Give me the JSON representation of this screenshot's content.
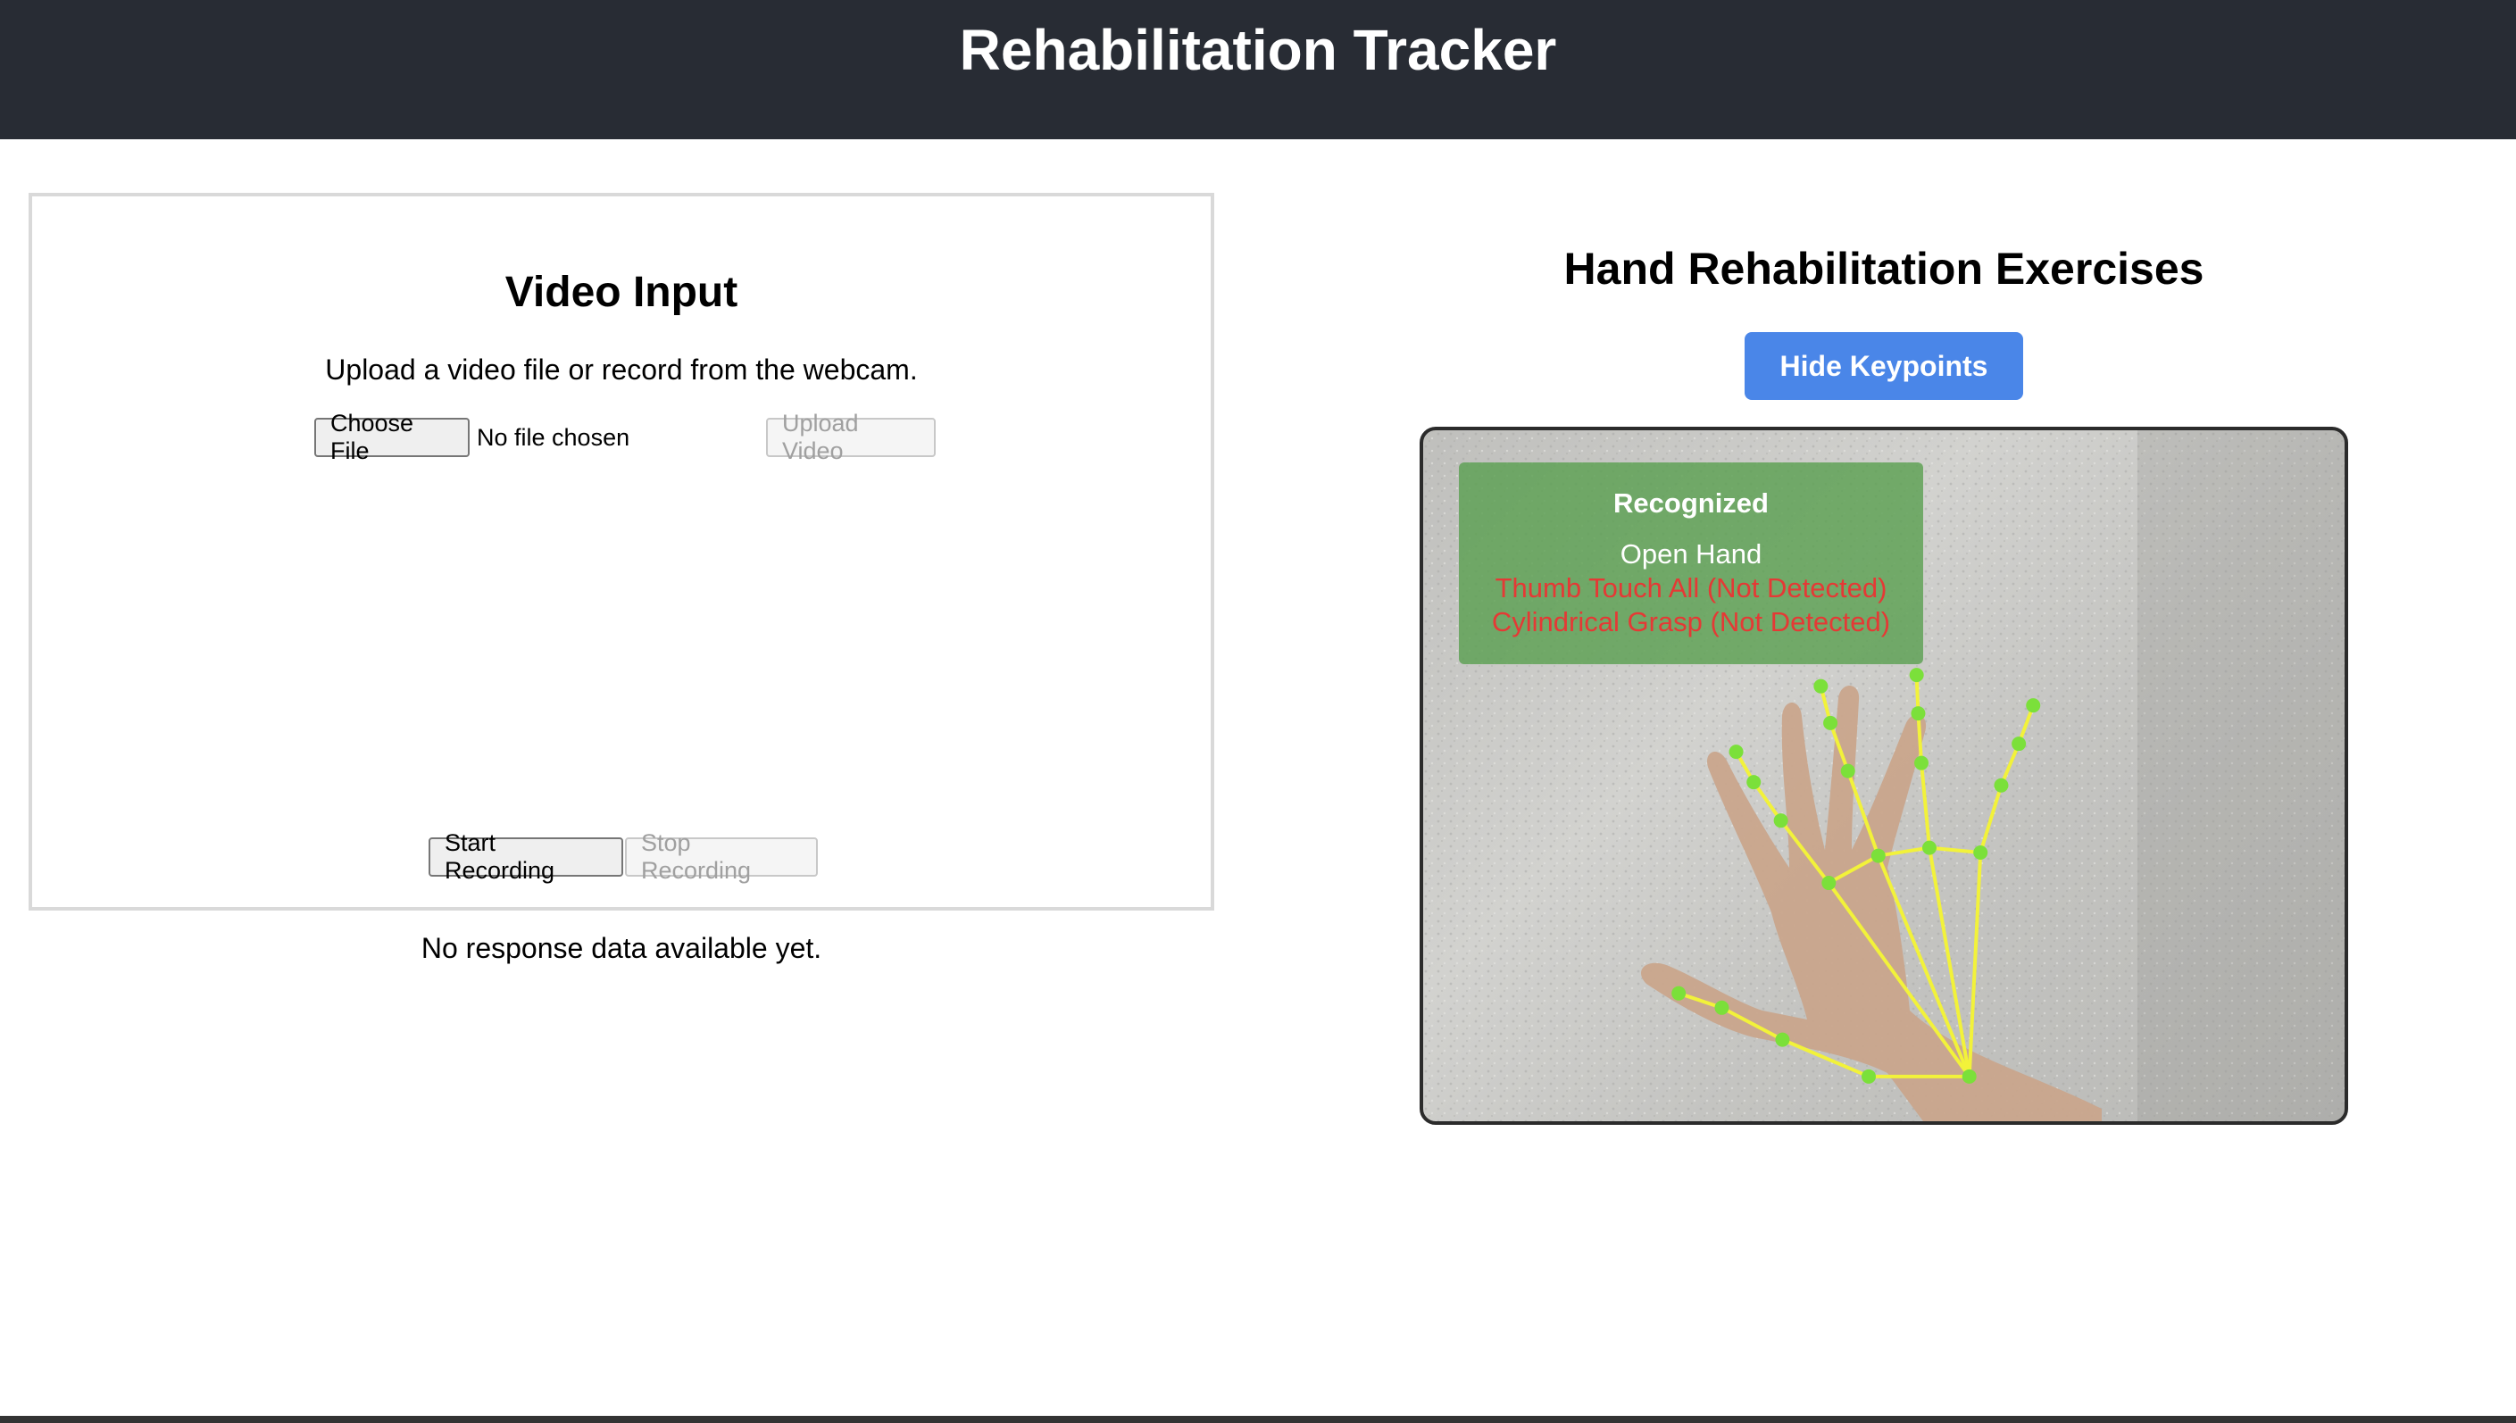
{
  "header": {
    "title": "Rehabilitation Tracker"
  },
  "video_input": {
    "title": "Video Input",
    "description": "Upload a video file or record from the webcam.",
    "choose_file_label": "Choose File",
    "file_status": "No file chosen",
    "upload_label": "Upload Video",
    "start_recording_label": "Start Recording",
    "stop_recording_label": "Stop Recording"
  },
  "response": {
    "message": "No response data available yet."
  },
  "exercises": {
    "title": "Hand Rehabilitation Exercises",
    "toggle_keypoints_label": "Hide Keypoints",
    "recognition": {
      "title": "Recognized",
      "items": [
        {
          "label": "Open Hand",
          "status": "detected"
        },
        {
          "label": "Thumb Touch All (Not Detected)",
          "status": "not-detected"
        },
        {
          "label": "Cylindrical Grasp (Not Detected)",
          "status": "not-detected"
        }
      ]
    },
    "colors": {
      "keypoint": "#7be03a",
      "connection": "#f2f23a",
      "detected": "#ffffff",
      "not_detected": "#e53935",
      "button": "#4a86e8"
    }
  }
}
